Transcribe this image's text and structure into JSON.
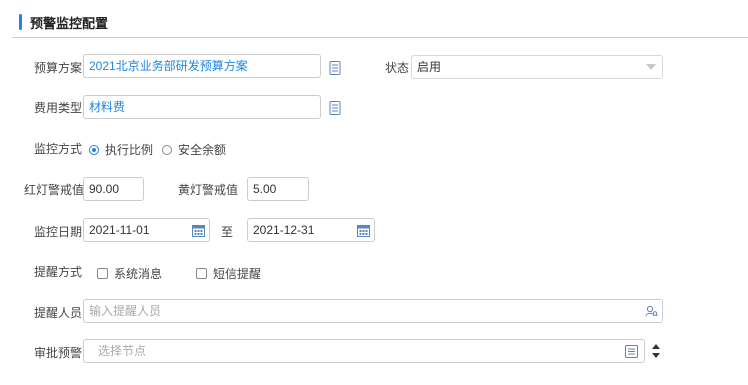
{
  "section": {
    "title": "预警监控配置"
  },
  "form": {
    "budget_plan": {
      "label": "预算方案",
      "value": "2021北京业务部研发预算方案"
    },
    "status": {
      "label": "状态",
      "value": "启用"
    },
    "expense_type": {
      "label": "费用类型",
      "value": "材料费"
    },
    "monitor_mode": {
      "label": "监控方式",
      "options": [
        {
          "label": "执行比例",
          "checked": true
        },
        {
          "label": "安全余额",
          "checked": false
        }
      ]
    },
    "red_threshold": {
      "label": "红灯警戒值",
      "value": "90.00"
    },
    "yellow_threshold": {
      "label": "黄灯警戒值",
      "value": "5.00"
    },
    "monitor_date": {
      "label": "监控日期",
      "start": "2021-11-01",
      "to": "至",
      "end": "2021-12-31"
    },
    "reminder_mode": {
      "label": "提醒方式",
      "options": [
        {
          "label": "系统消息",
          "checked": false
        },
        {
          "label": "短信提醒",
          "checked": false
        }
      ]
    },
    "reminder_person": {
      "label": "提醒人员",
      "placeholder": "输入提醒人员"
    },
    "approval_alert": {
      "label": "审批预警",
      "placeholder": "选择节点"
    }
  },
  "colors": {
    "accent": "#1f86e0",
    "border": "#cccccc",
    "divider": "#cfcfcf"
  },
  "icons": [
    "document-list-icon",
    "calendar-icon",
    "person-search-icon",
    "list-icon",
    "chevron-down-icon",
    "spin-up-icon",
    "spin-down-icon"
  ]
}
